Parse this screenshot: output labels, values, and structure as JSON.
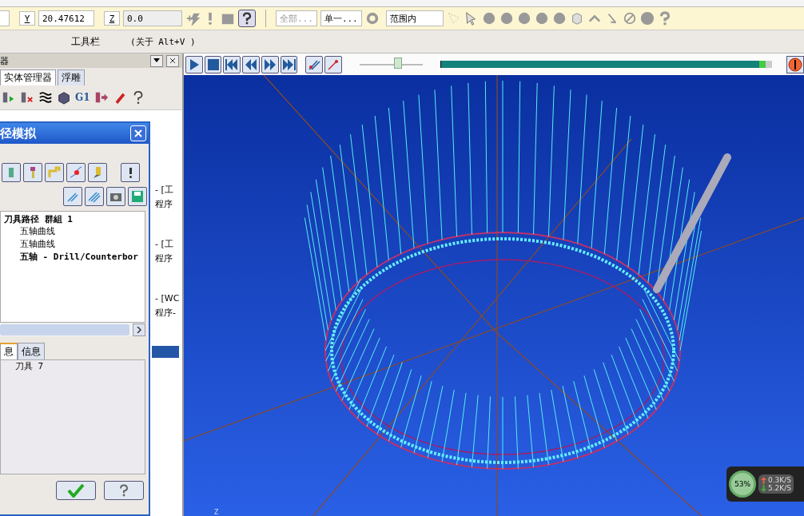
{
  "toolbar": {
    "y_label": "Y",
    "y_value": "20.47612",
    "z_label": "Z",
    "z_value": "0.0",
    "filter_all": "全部...",
    "filter_single": "单一...",
    "range_mode": "范围内"
  },
  "toolbar_hint": {
    "name": "工具栏",
    "shortcut": "(关于 Alt+V )"
  },
  "manager_panel": {
    "title": "器",
    "tabs": [
      {
        "label": "实体管理器",
        "selected": true
      },
      {
        "label": "浮雕",
        "selected": false
      }
    ],
    "g1_label": "G1"
  },
  "background_tree": [
    {
      "label": "- [工",
      "selected": false
    },
    {
      "label": "程序",
      "selected": false
    },
    {
      "label": "- [工",
      "selected": false
    },
    {
      "label": "程序",
      "selected": false
    },
    {
      "label": "- [WC",
      "selected": false
    },
    {
      "label": "程序-",
      "selected": false
    },
    {
      "selected": true
    }
  ],
  "dialog": {
    "title": "径模拟",
    "tree": {
      "label": "刀具路径 群組 1",
      "children": [
        {
          "label": "五轴曲线",
          "bold": false
        },
        {
          "label": "五轴曲线",
          "bold": false
        },
        {
          "label": "五轴 - Drill/Counterbor",
          "bold": true
        }
      ]
    },
    "tabs": [
      {
        "label": "息",
        "selected": true
      },
      {
        "label": "信息",
        "selected": false
      }
    ],
    "info": "刀具 7"
  },
  "player": {
    "slider": {
      "level": 0.6
    },
    "progress": {
      "level": 0.98
    }
  },
  "viewport": {
    "axis_label": "Z"
  },
  "net_monitor": {
    "percent": "53%",
    "upload": "0.3K/S",
    "download": "5.2K/S"
  }
}
